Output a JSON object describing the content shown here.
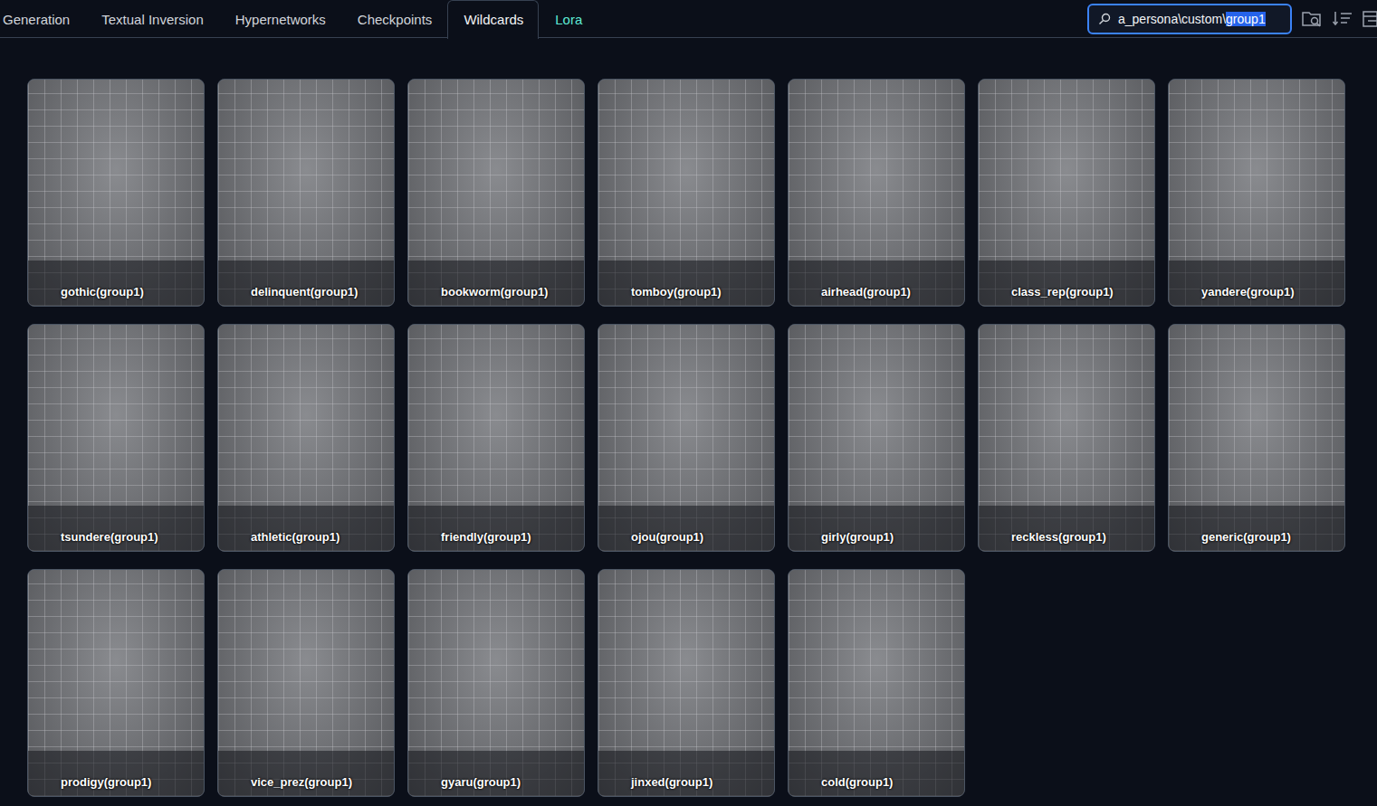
{
  "tabs": [
    {
      "label": "Generation",
      "selected": false,
      "color": "#d1d5db"
    },
    {
      "label": "Textual Inversion",
      "selected": false,
      "color": "#d1d5db"
    },
    {
      "label": "Hypernetworks",
      "selected": false,
      "color": "#d1d5db"
    },
    {
      "label": "Checkpoints",
      "selected": false,
      "color": "#d1d5db"
    },
    {
      "label": "Wildcards",
      "selected": true,
      "color": "#f3f4f6"
    },
    {
      "label": "Lora",
      "selected": false,
      "color": "#5eead4"
    }
  ],
  "search": {
    "parts": [
      {
        "text": "a_persona\\custom\\",
        "selected": false
      },
      {
        "text": "group1",
        "selected": true
      }
    ]
  },
  "cards": [
    {
      "name": "gothic(group1)"
    },
    {
      "name": "delinquent(group1)"
    },
    {
      "name": "bookworm(group1)"
    },
    {
      "name": "tomboy(group1)"
    },
    {
      "name": "airhead(group1)"
    },
    {
      "name": "class_rep(group1)"
    },
    {
      "name": "yandere(group1)"
    },
    {
      "name": "tsundere(group1)"
    },
    {
      "name": "athletic(group1)"
    },
    {
      "name": "friendly(group1)"
    },
    {
      "name": "ojou(group1)"
    },
    {
      "name": "girly(group1)"
    },
    {
      "name": "reckless(group1)"
    },
    {
      "name": "generic(group1)"
    },
    {
      "name": "prodigy(group1)"
    },
    {
      "name": "vice_prez(group1)"
    },
    {
      "name": "gyaru(group1)"
    },
    {
      "name": "jinxed(group1)"
    },
    {
      "name": "cold(group1)"
    }
  ]
}
